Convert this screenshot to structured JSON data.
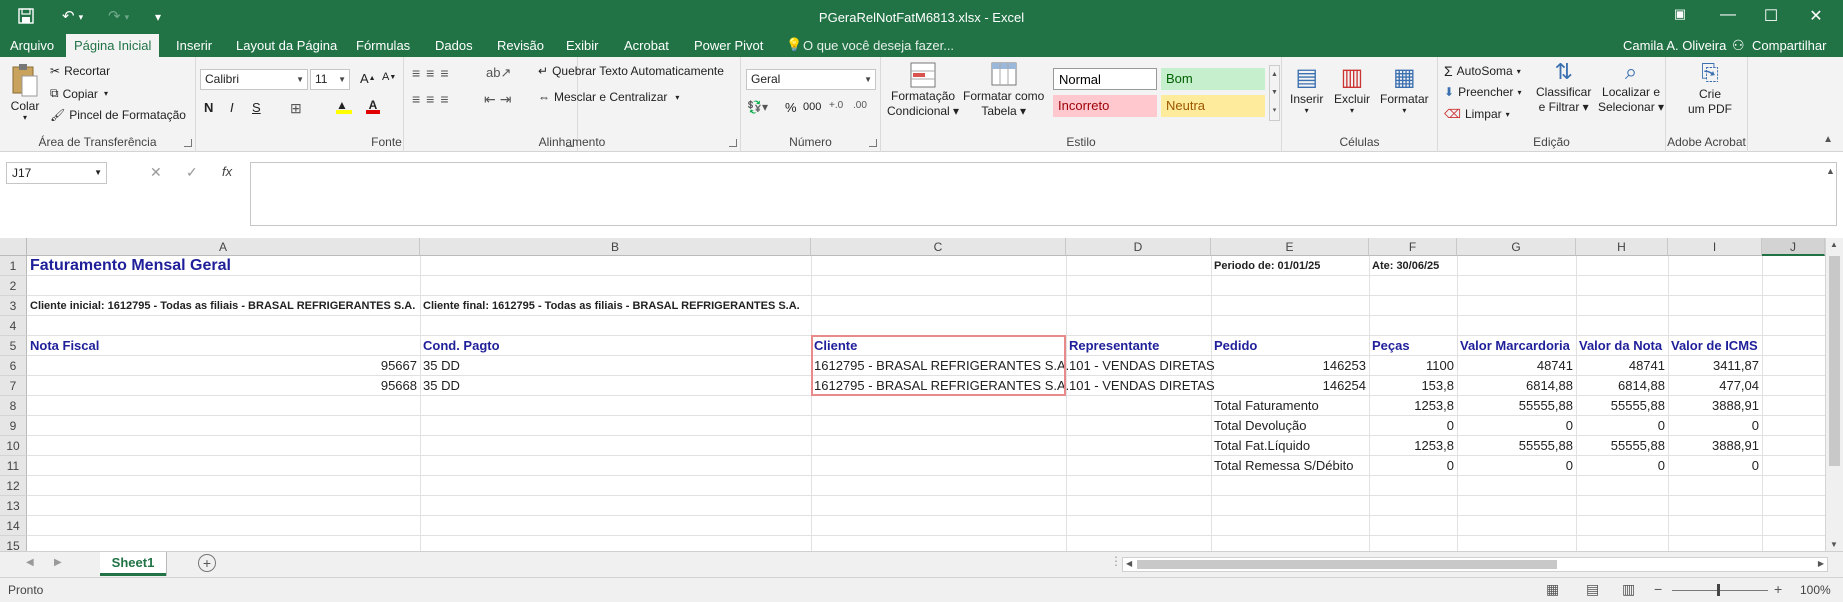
{
  "window": {
    "title": "PGeraRelNotFatM6813.xlsx - Excel",
    "qa_save_icon": "save-icon",
    "qa_undo_icon": "undo-icon",
    "qa_redo_icon": "redo-icon"
  },
  "menu": {
    "tabs": [
      "Arquivo",
      "Página Inicial",
      "Inserir",
      "Layout da Página",
      "Fórmulas",
      "Dados",
      "Revisão",
      "Exibir",
      "Acrobat",
      "Power Pivot"
    ],
    "active": "Página Inicial",
    "tell_me": "O que você deseja fazer...",
    "user": "Camila A. Oliveira",
    "share": "Compartilhar"
  },
  "ribbon": {
    "clipboard": {
      "paste": "Colar",
      "cut": "Recortar",
      "copy": "Copiar",
      "format_painter": "Pincel de Formatação",
      "label": "Área de Transferência"
    },
    "font": {
      "name": "Calibri",
      "size": "11",
      "bold": "N",
      "italic": "I",
      "underline": "S",
      "label": "Fonte"
    },
    "alignment": {
      "wrap": "Quebrar Texto Automaticamente",
      "merge": "Mesclar e Centralizar",
      "label": "Alinhamento"
    },
    "number": {
      "format": "Geral",
      "percent": "%",
      "thousands": "000",
      "label": "Número"
    },
    "styles": {
      "cond_format": [
        "Formatação",
        "Condicional"
      ],
      "format_table": [
        "Formatar como",
        "Tabela"
      ],
      "normal": "Normal",
      "good": "Bom",
      "bad": "Incorreto",
      "neutral": "Neutra",
      "label": "Estilo"
    },
    "cells": {
      "insert": "Inserir",
      "delete": "Excluir",
      "format": "Formatar",
      "label": "Células"
    },
    "editing": {
      "autosum": "AutoSoma",
      "fill": "Preencher",
      "clear": "Limpar",
      "sort": [
        "Classificar",
        "e Filtrar"
      ],
      "find": [
        "Localizar e",
        "Selecionar"
      ],
      "label": "Edição"
    },
    "acrobat": {
      "create": [
        "Crie",
        "um PDF"
      ],
      "label": "Adobe Acrobat"
    }
  },
  "formula_bar": {
    "name_box": "J17",
    "fx": "fx",
    "content": ""
  },
  "columns": [
    "A",
    "B",
    "C",
    "D",
    "E",
    "F",
    "G",
    "H",
    "I",
    "J"
  ],
  "rows": [
    "1",
    "2",
    "3",
    "4",
    "5",
    "6",
    "7",
    "8",
    "9",
    "10",
    "11",
    "12",
    "13",
    "14",
    "15"
  ],
  "sheet": {
    "title": "Faturamento Mensal Geral",
    "periodo": "Periodo de: 01/01/25",
    "ate": "Ate: 30/06/25",
    "cliente_inicial": "Cliente inicial: 1612795 - Todas as filiais - BRASAL REFRIGERANTES S.A.",
    "cliente_final": "Cliente final:  1612795 - Todas as filiais - BRASAL REFRIGERANTES S.A.",
    "headers": [
      "Nota Fiscal",
      "Cond. Pagto",
      "Cliente",
      "Representante",
      "Pedido",
      "Peças",
      "Valor Marcardoria",
      "Valor da Nota",
      "Valor de ICMS"
    ],
    "data_rows": [
      [
        "95667",
        "35 DD",
        "1612795 - BRASAL REFRIGERANTES S.A.",
        "101 - VENDAS DIRETAS",
        "146253",
        "1100",
        "48741",
        "48741",
        "3411,87"
      ],
      [
        "95668",
        "35 DD",
        "1612795 - BRASAL REFRIGERANTES S.A.",
        "101 - VENDAS DIRETAS",
        "146254",
        "153,8",
        "6814,88",
        "6814,88",
        "477,04"
      ]
    ],
    "totals": [
      [
        "Total Faturamento",
        "1253,8",
        "55555,88",
        "55555,88",
        "3888,91"
      ],
      [
        "Total Devolução",
        "0",
        "0",
        "0",
        "0"
      ],
      [
        "Total Fat.Líquido",
        "1253,8",
        "55555,88",
        "55555,88",
        "3888,91"
      ],
      [
        "Total Remessa S/Débito",
        "0",
        "0",
        "0",
        "0"
      ]
    ]
  },
  "tabs": {
    "sheet": "Sheet1"
  },
  "status": {
    "ready": "Pronto",
    "zoom": "100%"
  }
}
